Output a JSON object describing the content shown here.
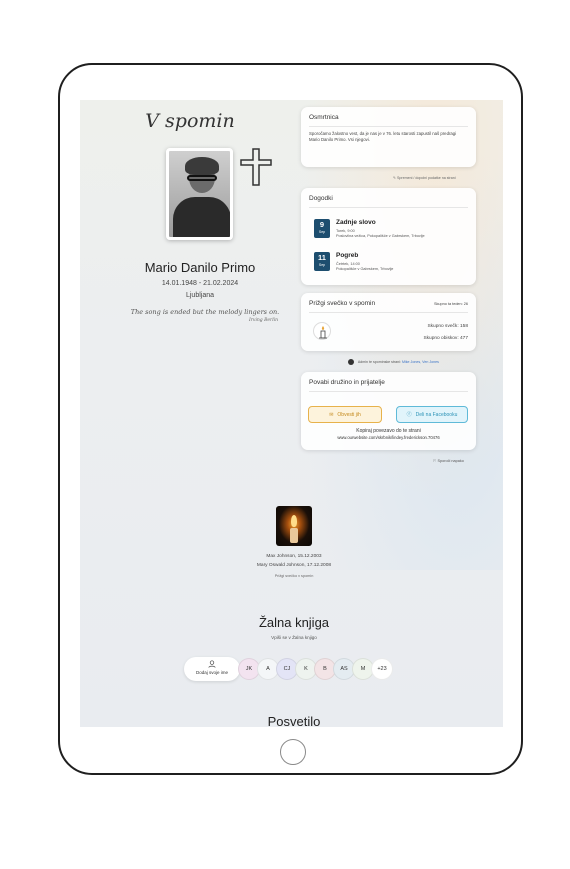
{
  "memorial": {
    "title": "V spomin",
    "name": "Mario Danilo Primo",
    "dates": "14.01.1948 - 21.02.2024",
    "city": "Ljubljana",
    "quote": "The song is ended but the melody lingers on.",
    "quote_author": "Irving Berlin"
  },
  "obituary": {
    "title": "Osmrtnica",
    "text": "Sporočamo žalostno vest, da je nas je v 76. letu starosti zapustil naš predragi Mario Danilo Primo. Vsi njegovi.",
    "edit_link": "Spremeni / dopolni podatke na strani"
  },
  "events": {
    "title": "Dogodki",
    "items": [
      {
        "day": "9",
        "month": "Sep",
        "title": "Zadnje slovo",
        "line1": "Torek, 9:00",
        "line2": "Poslovilna vežica, Pokopališče v Gabrskem, Trbovlje"
      },
      {
        "day": "11",
        "month": "Sep",
        "title": "Pogreb",
        "line1": "Četrtek, 14:00",
        "line2": "Pokopališče v Gabrskem, Trbovlje"
      }
    ]
  },
  "candles": {
    "title": "Prižgi svečko v spomin",
    "week": "Skupno ta teden: 26",
    "total": "Skupno svečk: 158",
    "visits": "Skupno obiskov: 477"
  },
  "admin": {
    "prefix": "Admin te spominske strani:",
    "names": "Mike Jones, Ven Jones"
  },
  "invite": {
    "title": "Povabi družino in prijatelje",
    "notify_label": "Obvesti jih",
    "share_label": "Deli na Facebooku",
    "copy_label": "Kopiraj povezavo do te strani",
    "url": "www.ourwebsite.com/skrbnik/lindey.frederickson.70476"
  },
  "report_label": "Sporoči napako",
  "lit": {
    "lines": [
      "Max Johnson, 15.12.2003",
      "Mary Oswald Johnson, 17.12.2008"
    ],
    "cta": "Prižgi svečko v spomin"
  },
  "book": {
    "title": "Žalna knjiga",
    "subtitle": "Vpiši se v Žalna knjigo",
    "add_label": "Dodaj svoje ime",
    "avatars": [
      {
        "initials": "JK",
        "color": "#f3e3f0"
      },
      {
        "initials": "A",
        "color": "#f4f6f8"
      },
      {
        "initials": "CJ",
        "color": "#e3e4f6"
      },
      {
        "initials": "K",
        "color": "#eef3ef"
      },
      {
        "initials": "B",
        "color": "#f3e4e6"
      },
      {
        "initials": "AS",
        "color": "#e4ecf1"
      },
      {
        "initials": "M",
        "color": "#eef4ec"
      },
      {
        "initials": "+23",
        "color": "#ffffff"
      }
    ]
  },
  "dedication_title": "Posvetilo"
}
